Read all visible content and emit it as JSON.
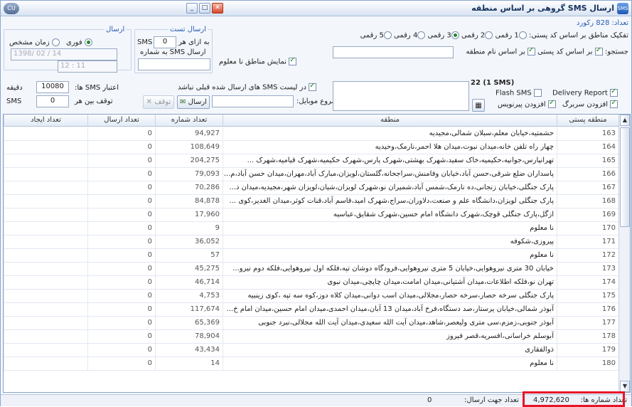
{
  "window": {
    "title": "ارسال SMS گروهی بر اساس منطقه",
    "app_icon": "SMS",
    "cu_icon": "CU"
  },
  "info": {
    "record_count": "تعداد: 828 رکورد",
    "separate_label": "تفکیک مناطق بر اساس کد پستی:",
    "digits": [
      "1 رقمی",
      "2 رقمی",
      "3 رقمی",
      "4 رقمی",
      "5 رقمی"
    ],
    "digits_selected": 2,
    "search_label": "جستجو:",
    "by_postal": "بر اساس کد پستی",
    "by_name": "بر اساس نام منطقه",
    "show_unknown": "نمایش مناطق نا معلوم",
    "search_value": ""
  },
  "send_group": {
    "legend": "ارسال",
    "instant": "فوری",
    "scheduled": "زمان مشخص",
    "date_value": "1398/ 02 / 14",
    "time_value": "12 : 11",
    "send_selected": "instant"
  },
  "test_group": {
    "legend": "ارسال تست",
    "per_each": "به ازای هر",
    "per_value": "0",
    "sms": "SMS",
    "send_to": "ارسال SMS به شماره",
    "number_value": ""
  },
  "validity": {
    "label": "اعتبار SMS ها:",
    "value": "10080",
    "unit": "دقیقه",
    "pause_label": "توقف بین هر",
    "pause_value": "0",
    "pause_unit": "SMS"
  },
  "message": {
    "count_label": "22 (1 SMS)",
    "flash": "Flash SMS",
    "delivery": "Delivery Report",
    "add_header": "افزودن سربرگ",
    "add_footer": "افزودن پیرنویس",
    "exclude_sent": "در لیست SMS های ارسال شده قبلی نباشد",
    "start_mobile": "شروع موبایل:",
    "start_value": "",
    "text_value": "",
    "send_btn": "ارسال",
    "stop_btn": "توقف"
  },
  "grid": {
    "headers": [
      "منطقه پستی",
      "منطقه",
      "تعداد شماره",
      "تعداد ارسال",
      "تعداد ایجاد"
    ],
    "rows": [
      [
        "163",
        "حشمتیه،خیابان معلم،سبلان شمالی،مجیدیه",
        "94,927",
        "0"
      ],
      [
        "164",
        "چهار راه تلفن خانه،میدان نبوت،میدان هلا احمر،نارمک،وحیدیه",
        "108,649",
        "0"
      ],
      [
        "165",
        "تهرانپارس،جوانیه،حکیمیه،خاک سفید،شهرک بهشتی،شهرک پارس،شهرک حکیمیه،شهرک قیامیه،شهرک ...",
        "204,275",
        "0"
      ],
      [
        "166",
        "پاسداران ضلع شرقی،حسن آباد،خیابان وفامنش،سراجحانه،گلستان،لویزان،مبارک آباد،مهران،میدان حسن آباد،م...",
        "79,093",
        "0"
      ],
      [
        "167",
        "پارک جنگلی،خیابان زنجانی،ده نارمک،شمس آباد،شمیران نو،شهرک لویزان،شیان،لویزان شهر،مجیدیه،میدان د...",
        "70,286",
        "0"
      ],
      [
        "168",
        "پارک جنگلی لویزان،دانشگاه علم و صنعت،دلاوران،سراج،شهرک امید،قاسم آباد،قنات کوثر،میدان الغدیر،کوی ...",
        "84,878",
        "0"
      ],
      [
        "169",
        "ازگل،پارک جنگلی قوچک،شهرک دانشگاه امام حسین،شهرک شقایق،عباسیه",
        "17,960",
        "0"
      ],
      [
        "170",
        "نا معلوم",
        "9",
        "0"
      ],
      [
        "171",
        "پیروزی،شکوفه",
        "36,052",
        "0"
      ],
      [
        "172",
        "نا معلوم",
        "57",
        "0"
      ],
      [
        "173",
        "خیابان 30 متری نیروهوایی،خیابان 5 متری نیروهوایی،فرودگاه دوشان تپه،فلکه اول نیروهوایی،فلکه دوم نیرو...",
        "45,275",
        "0"
      ],
      [
        "174",
        "تهران نو،فلکه اطلاعات،میدان آشتیانی،میدان امامت،میدان چاپچی،میدان نبوی",
        "46,714",
        "0"
      ],
      [
        "175",
        "پارک جنگلی سرخه حصار،سرخه حصار،مجلالی،میدان اسب دوانی،میدان کلاه دوز،کوه سه تپه ،کوی زینبیه",
        "4,753",
        "0"
      ],
      [
        "176",
        "آبوذر شمالی،خیابان پرستار،صد دستگاه،فرخ آباد،میدان 13 آبان،میدان احمدی،میدان امام حسین،میدان امام خ...",
        "117,674",
        "0"
      ],
      [
        "177",
        "آبوذر جنوبی،زمزم،سی متری ولیعصر،شاهد،میدان آیت الله سعیدی،میدان آیت الله مجلالی،نبرد جنوبی",
        "65,369",
        "0"
      ],
      [
        "178",
        "آبوسلم خراسانی،افسریه،قصر فیروز",
        "78,904",
        "0"
      ],
      [
        "179",
        "ذوالفقاری",
        "43,434",
        "0"
      ],
      [
        "180",
        "نا معلوم",
        "14",
        "0"
      ]
    ]
  },
  "status": {
    "numbers_label": "تعداد شماره ها:",
    "numbers_value": "4,972,620",
    "to_send_label": "تعداد جهت ارسال:",
    "to_send_value": "0"
  }
}
